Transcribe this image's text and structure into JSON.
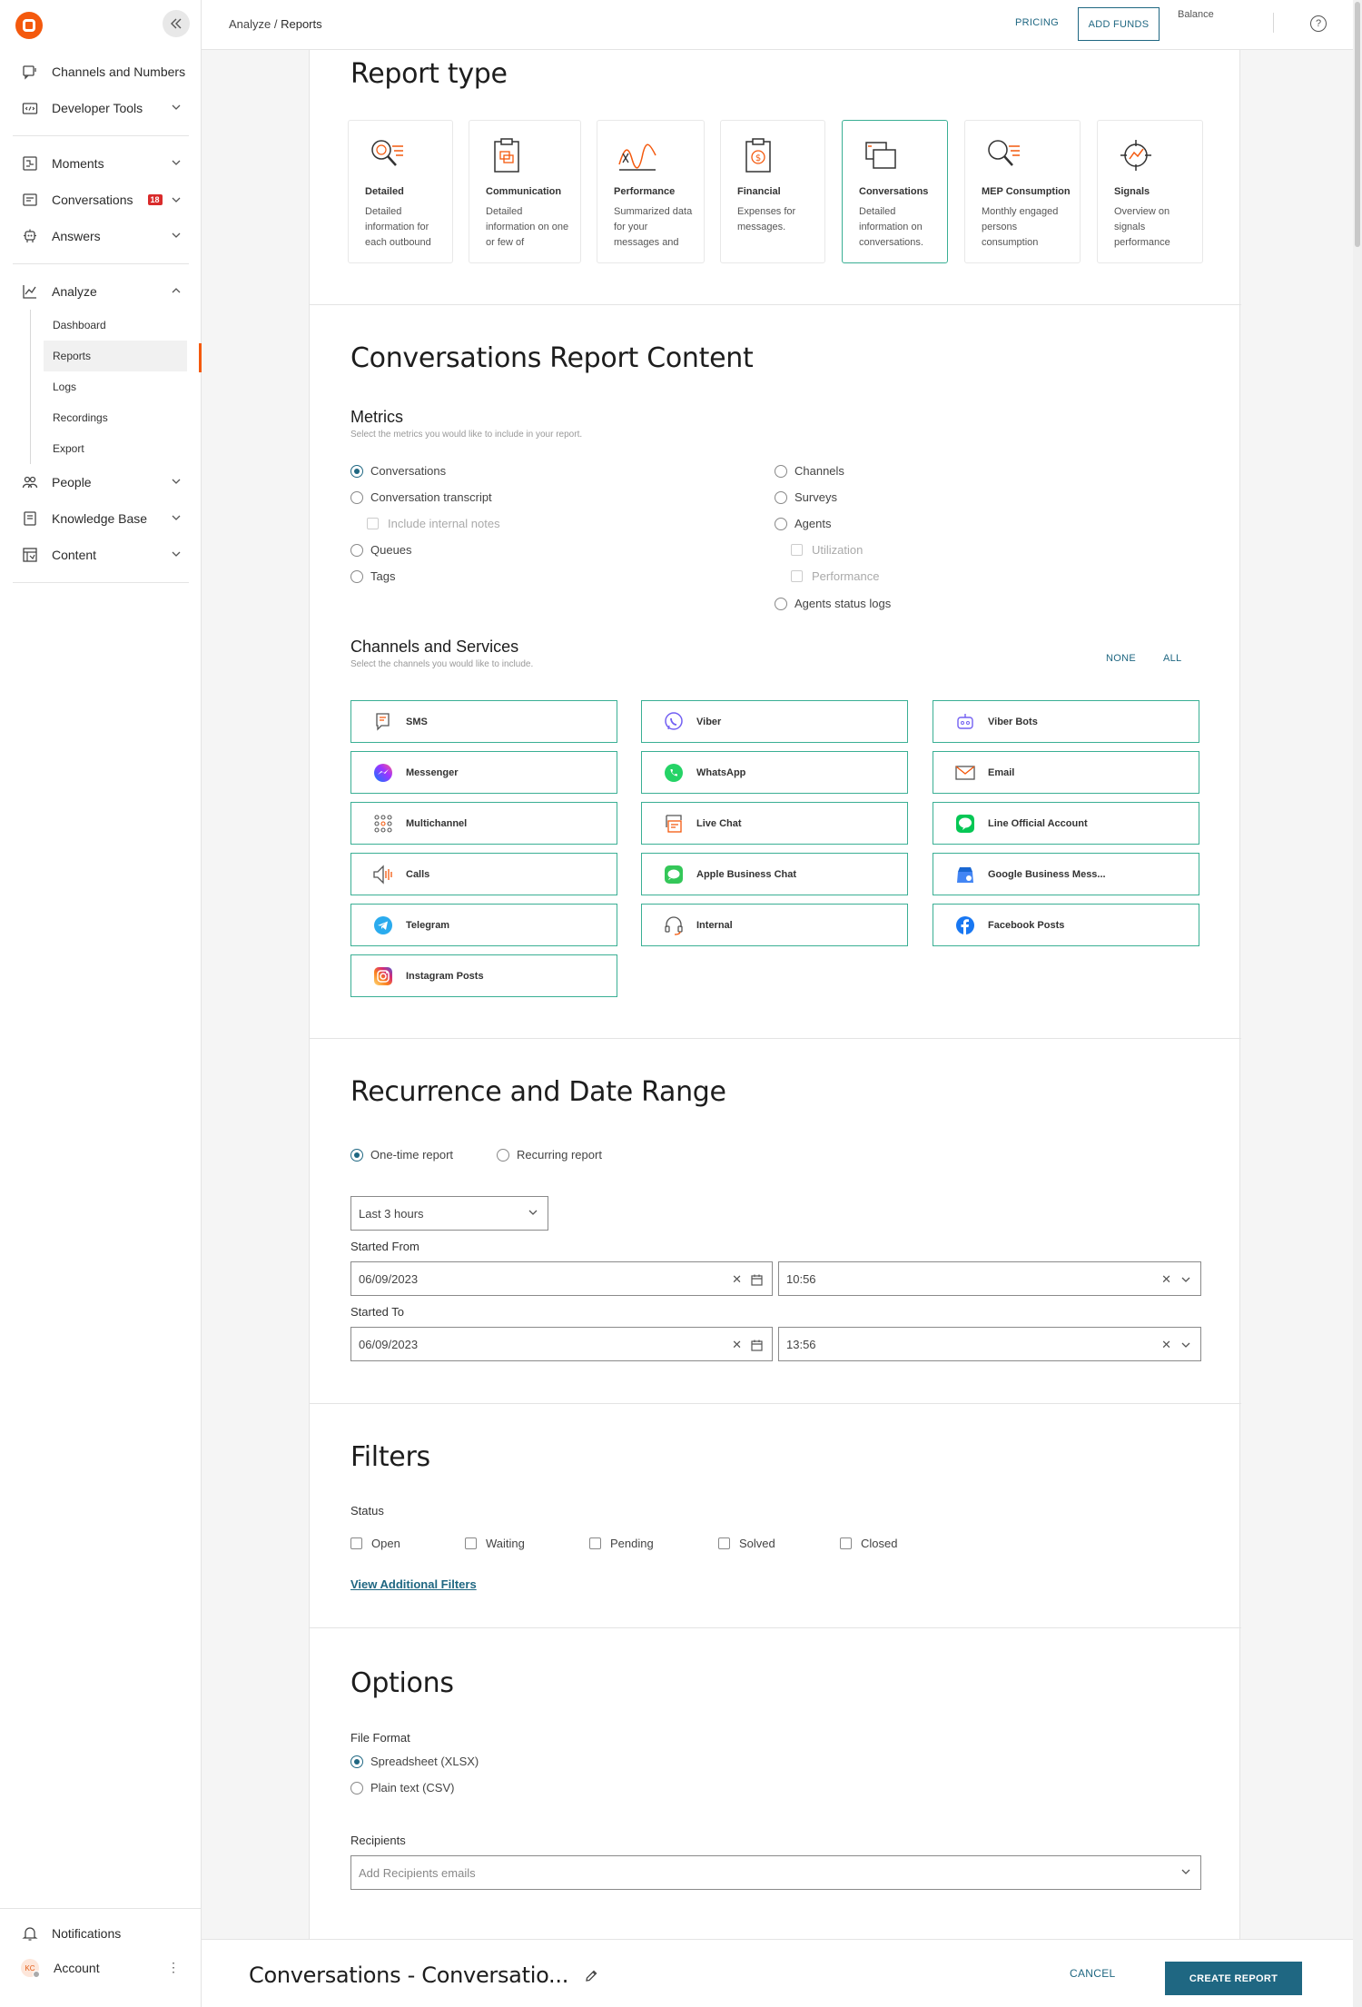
{
  "sidebar": {
    "items": [
      {
        "label": "Channels and Numbers",
        "icon": "channels-icon"
      },
      {
        "label": "Developer Tools",
        "icon": "developer-tools-icon"
      },
      {
        "label": "Moments",
        "icon": "moments-icon"
      },
      {
        "label": "Conversations",
        "icon": "conversations-icon",
        "badge": "18"
      },
      {
        "label": "Answers",
        "icon": "answers-icon"
      },
      {
        "label": "Analyze",
        "icon": "analyze-icon"
      },
      {
        "label": "People",
        "icon": "people-icon"
      },
      {
        "label": "Knowledge Base",
        "icon": "knowledge-base-icon"
      },
      {
        "label": "Content",
        "icon": "content-icon"
      }
    ],
    "analyze_sub": [
      "Dashboard",
      "Reports",
      "Logs",
      "Recordings",
      "Export"
    ],
    "notifications": "Notifications",
    "account": "Account",
    "avatar_initials": "KC"
  },
  "topbar": {
    "crumb_parent": "Analyze",
    "crumb_sep": " / ",
    "crumb_current": "Reports",
    "pricing": "PRICING",
    "add_funds": "ADD FUNDS",
    "balance": "Balance",
    "help": "?"
  },
  "report_type": {
    "title": "Report type",
    "types": [
      {
        "title": "Detailed",
        "desc": "Detailed information for each outbound"
      },
      {
        "title": "Communication",
        "desc": "Detailed information on one or few of"
      },
      {
        "title": "Performance",
        "desc": "Summarized data for your messages and"
      },
      {
        "title": "Financial",
        "desc": "Expenses for messages."
      },
      {
        "title": "Conversations",
        "desc": "Detailed information on conversations."
      },
      {
        "title": "MEP Consumption",
        "desc": "Monthly engaged persons consumption"
      },
      {
        "title": "Signals",
        "desc": "Overview on signals performance"
      }
    ],
    "selected": "Conversations"
  },
  "content": {
    "title": "Conversations Report Content",
    "metrics_title": "Metrics",
    "metrics_hint": "Select the metrics you would like to include in your report.",
    "metrics_left": [
      "Conversations",
      "Conversation transcript",
      "Include internal notes",
      "Queues",
      "Tags"
    ],
    "metrics_right": [
      "Channels",
      "Surveys",
      "Agents",
      "Utilization",
      "Performance",
      "Agents status logs"
    ],
    "channels_title": "Channels and Services",
    "channels_hint": "Select the channels you would like to include.",
    "none": "NONE",
    "all": "ALL",
    "channels": [
      "SMS",
      "Viber",
      "Viber Bots",
      "Messenger",
      "WhatsApp",
      "Email",
      "Multichannel",
      "Live Chat",
      "Line Official Account",
      "Calls",
      "Apple Business Chat",
      "Google Business Mess...",
      "Telegram",
      "Internal",
      "Facebook Posts",
      "Instagram Posts"
    ]
  },
  "recurrence": {
    "title": "Recurrence and Date Range",
    "one_time": "One-time report",
    "recurring": "Recurring report",
    "range": "Last 3 hours",
    "started_from": "Started From",
    "started_to": "Started To",
    "from_date": "06/09/2023",
    "from_time": "10:56",
    "to_date": "06/09/2023",
    "to_time": "13:56"
  },
  "filters": {
    "title": "Filters",
    "status_label": "Status",
    "statuses": [
      "Open",
      "Waiting",
      "Pending",
      "Solved",
      "Closed"
    ],
    "view_more": "View Additional Filters"
  },
  "options": {
    "title": "Options",
    "format_label": "File Format",
    "xlsx": "Spreadsheet (XLSX)",
    "csv": "Plain text (CSV)",
    "recipients_label": "Recipients",
    "recipients_placeholder": "Add Recipients emails"
  },
  "footer": {
    "title": "Conversations - Conversatio...",
    "cancel": "CANCEL",
    "create": "CREATE REPORT"
  },
  "colors": {
    "accent": "#1f6782",
    "brand": "#f4590d",
    "selected_border": "#3aaf94"
  }
}
